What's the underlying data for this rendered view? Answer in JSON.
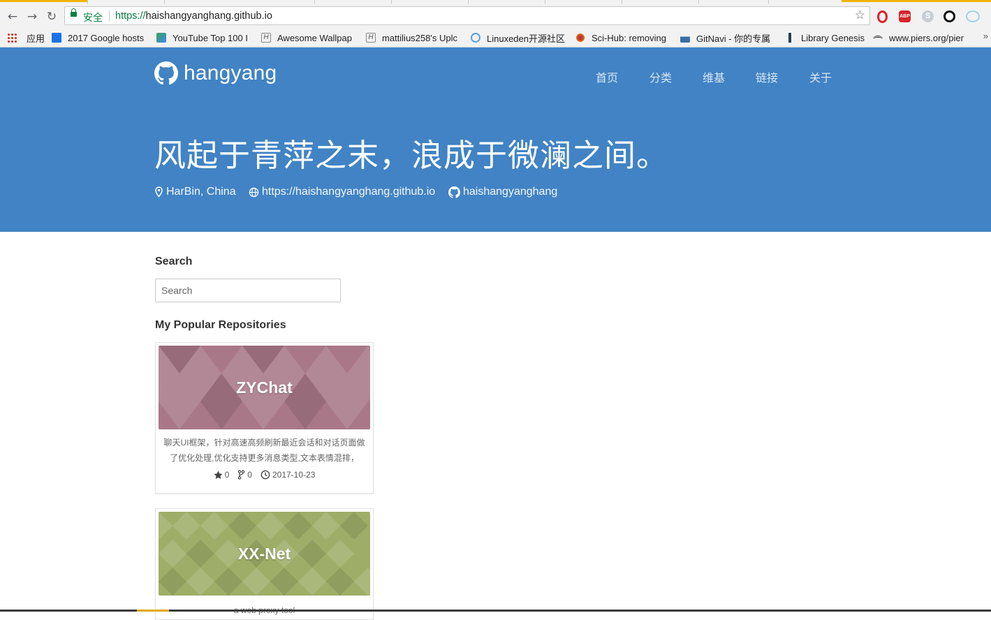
{
  "browser": {
    "secure_label": "安全",
    "url_scheme": "https://",
    "url_host": "haishangyanghang.github.io",
    "bookmarks": [
      {
        "label": "应用",
        "icon": "apps-grid-icon"
      },
      {
        "label": "2017 Google hosts",
        "icon": "bookmark-blue-icon"
      },
      {
        "label": "YouTube Top 100 I",
        "icon": "youtube-map-icon"
      },
      {
        "label": "Awesome Wallpap",
        "icon": "hexo-h-icon"
      },
      {
        "label": "mattilius258's Uplc",
        "icon": "hexo-h-icon"
      },
      {
        "label": "Linuxeden开源社区",
        "icon": "linuxeden-icon"
      },
      {
        "label": "Sci-Hub: removing",
        "icon": "scihub-eye-icon"
      },
      {
        "label": "GitNavi - 你的专属",
        "icon": "gitnavi-icon"
      },
      {
        "label": "Library Genesis",
        "icon": "libgen-icon"
      },
      {
        "label": "www.piers.org/pier",
        "icon": "piers-icon"
      }
    ],
    "more_label": "»"
  },
  "site": {
    "brand": "hangyang",
    "nav": [
      "首页",
      "分类",
      "维基",
      "链接",
      "关于"
    ],
    "motto": "风起于青萍之末，浪成于微澜之间。",
    "location": "HarBin, China",
    "website": "https://haishangyanghang.github.io",
    "github": "haishangyanghang"
  },
  "sidebar": {
    "search_heading": "Search",
    "search_placeholder": "Search",
    "repos_heading": "My Popular Repositories",
    "repos": [
      {
        "name": "ZYChat",
        "description": "聊天UI框架，针对高速高频刷新最近会话和对话页面做了优化处理,优化支持更多消息类型,文本表情混排，",
        "stars": "0",
        "forks": "0",
        "updated": "2017-10-23",
        "cover_color": "#a97888"
      },
      {
        "name": "XX-Net",
        "description": "a web proxy tool",
        "stars": "",
        "forks": "",
        "updated": "",
        "cover_color": "#9eae68"
      }
    ]
  },
  "colors": {
    "hero": "#4183c4",
    "secure": "#0b8043"
  }
}
